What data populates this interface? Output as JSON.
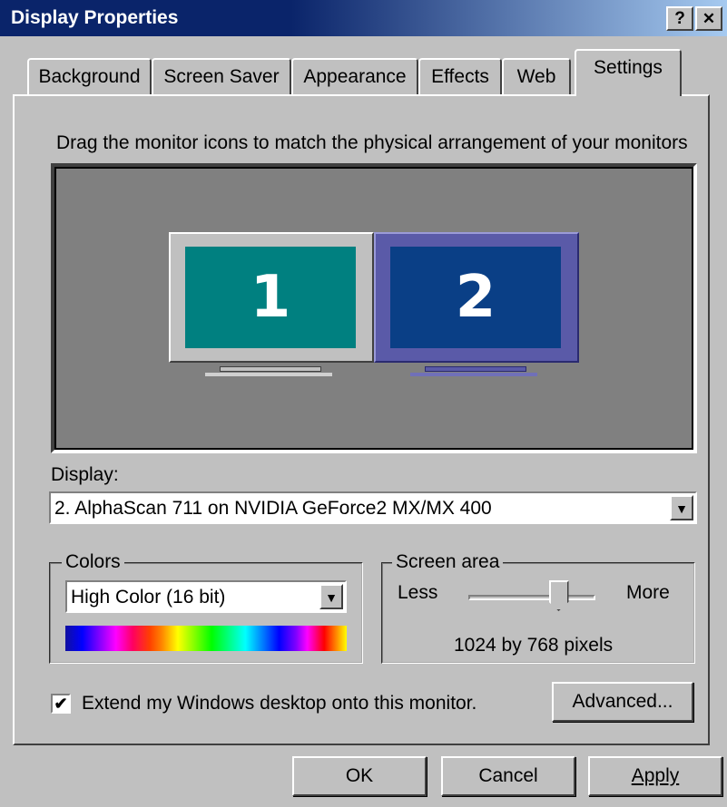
{
  "window": {
    "title": "Display Properties",
    "help_glyph": "?",
    "close_glyph": "✕"
  },
  "tabs": [
    {
      "label": "Background"
    },
    {
      "label": "Screen Saver"
    },
    {
      "label": "Appearance"
    },
    {
      "label": "Effects"
    },
    {
      "label": "Web"
    },
    {
      "label": "Settings",
      "active": true
    }
  ],
  "settings": {
    "instruction": "Drag the monitor icons to match the physical arrangement of your monitors",
    "monitors": [
      {
        "number": "1",
        "screen_color": "#008080",
        "bezel_color": "#c0c0c0"
      },
      {
        "number": "2",
        "screen_color": "#0a3f86",
        "bezel_color": "#5a5aa8",
        "selected": true
      }
    ],
    "display_label": "Display:",
    "display_value": "2. AlphaScan 711 on NVIDIA GeForce2 MX/MX 400",
    "colors": {
      "group_label": "Colors",
      "value": "High Color (16 bit)"
    },
    "screen_area": {
      "group_label": "Screen area",
      "less_label": "Less",
      "more_label": "More",
      "slider_position": 0.75,
      "resolution_text": "1024 by 768 pixels"
    },
    "extend_desktop": {
      "checked": true,
      "label": "Extend my Windows desktop onto this monitor."
    },
    "advanced_label": "Advanced..."
  },
  "footer": {
    "ok_label": "OK",
    "cancel_label": "Cancel",
    "apply_label": "Apply"
  }
}
